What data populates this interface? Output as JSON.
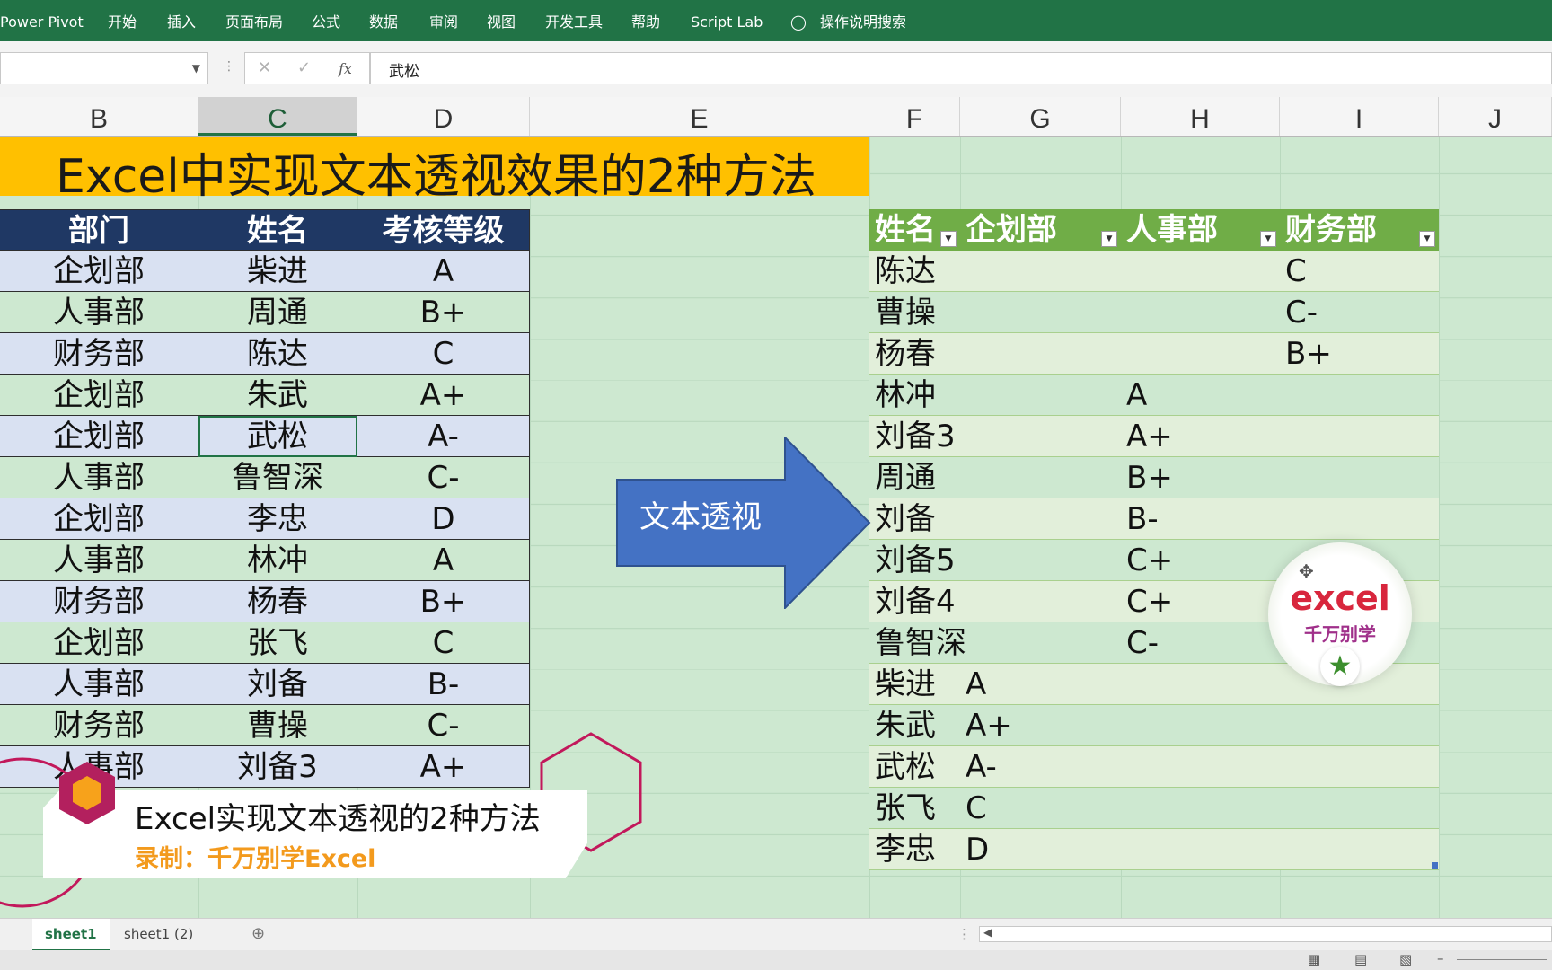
{
  "ribbon": {
    "tabs": [
      "Power Pivot",
      "开始",
      "插入",
      "页面布局",
      "公式",
      "数据",
      "审阅",
      "视图",
      "开发工具",
      "帮助",
      "Script Lab"
    ],
    "search_label": "操作说明搜索"
  },
  "formula_bar": {
    "name_box": "",
    "cancel_icon": "✕",
    "enter_icon": "✓",
    "fx_label": "fx",
    "value": "武松"
  },
  "columns": [
    "B",
    "C",
    "D",
    "E",
    "F",
    "G",
    "H",
    "I",
    "J"
  ],
  "selected_column": "C",
  "sheet_title": "Excel中实现文本透视效果的2种方法",
  "source_table": {
    "headers": [
      "部门",
      "姓名",
      "考核等级"
    ],
    "rows": [
      [
        "企划部",
        "柴进",
        "A"
      ],
      [
        "人事部",
        "周通",
        "B+"
      ],
      [
        "财务部",
        "陈达",
        "C"
      ],
      [
        "企划部",
        "朱武",
        "A+"
      ],
      [
        "企划部",
        "武松",
        "A-"
      ],
      [
        "人事部",
        "鲁智深",
        "C-"
      ],
      [
        "企划部",
        "李忠",
        "D"
      ],
      [
        "人事部",
        "林冲",
        "A"
      ],
      [
        "财务部",
        "杨春",
        "B+"
      ],
      [
        "企划部",
        "张飞",
        "C"
      ],
      [
        "人事部",
        "刘备",
        "B-"
      ],
      [
        "财务部",
        "曹操",
        "C-"
      ],
      [
        "人事部",
        "刘备3",
        "A+"
      ]
    ]
  },
  "arrow_label": "文本透视",
  "pivot_table": {
    "headers": [
      "姓名",
      "企划部",
      "人事部",
      "财务部"
    ],
    "rows": [
      [
        "陈达",
        "",
        "",
        "C"
      ],
      [
        "曹操",
        "",
        "",
        "C-"
      ],
      [
        "杨春",
        "",
        "",
        "B+"
      ],
      [
        "林冲",
        "",
        "A",
        ""
      ],
      [
        "刘备3",
        "",
        "A+",
        ""
      ],
      [
        "周通",
        "",
        "B+",
        ""
      ],
      [
        "刘备",
        "",
        "B-",
        ""
      ],
      [
        "刘备5",
        "",
        "C+",
        ""
      ],
      [
        "刘备4",
        "",
        "C+",
        ""
      ],
      [
        "鲁智深",
        "",
        "C-",
        ""
      ],
      [
        "柴进",
        "A",
        "",
        ""
      ],
      [
        "朱武",
        "A+",
        "",
        ""
      ],
      [
        "武松",
        "A-",
        "",
        ""
      ],
      [
        "张飞",
        "C",
        "",
        ""
      ],
      [
        "李忠",
        "D",
        "",
        ""
      ]
    ]
  },
  "logo": {
    "line1": "excel",
    "line2": "千万别学"
  },
  "caption": {
    "title": "Excel实现文本透视的2种方法",
    "subtitle": "录制：千万别学Excel"
  },
  "sheet_tabs": [
    "sheet1",
    "sheet1 (2)"
  ],
  "active_sheet": "sheet1",
  "colors": {
    "ribbon": "#217346",
    "title_fill": "#ffc000",
    "header_fill": "#1f3864",
    "pivot_header": "#70ad47",
    "arrow": "#4472c4",
    "grid": "#cde8d0"
  }
}
